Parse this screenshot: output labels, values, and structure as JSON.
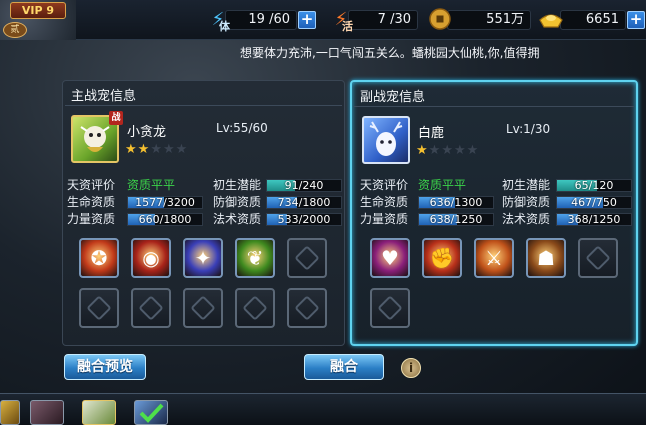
{
  "top_bar": {
    "vip_label": "VIP 9",
    "rank_label": "贰",
    "stamina": {
      "icon": "lightning-icon",
      "tag": "体",
      "value": "19 /60"
    },
    "vitality": {
      "icon": "lightning-icon",
      "tag": "活",
      "value": "7 /30"
    },
    "coins": {
      "icon": "copper-coin-icon",
      "value": "551万"
    },
    "gold": {
      "icon": "gold-ingot-icon",
      "value": "6651"
    }
  },
  "marquee": "想要体力充沛,一口气闯五关么。蟠桃园大仙桃,你,值得拥",
  "main_panel": {
    "title": "主战宠信息",
    "battle_tag": "战",
    "pet_name": "小贪龙",
    "level": "Lv:55/60",
    "stars_filled": 2,
    "stars_total": 5,
    "rating_label": "天资评价",
    "rating_value": "资质平平",
    "potential_label": "初生潜能",
    "potential_text": "91/240",
    "potential_fraction": 0.38,
    "stats": [
      {
        "label": "生命资质",
        "text": "1577/3200",
        "fraction": 0.49
      },
      {
        "label": "力量资质",
        "text": "660/1800",
        "fraction": 0.37
      }
    ],
    "stats_right": [
      {
        "label": "防御资质",
        "text": "734/1800",
        "fraction": 0.41
      },
      {
        "label": "法术资质",
        "text": "533/2000",
        "fraction": 0.27
      }
    ],
    "skills": [
      {
        "name": "shield-fire-skill-icon",
        "color": "#c13a1a"
      },
      {
        "name": "flame-ring-skill-icon",
        "color": "#a8231a"
      },
      {
        "name": "lightning-spear-skill-icon",
        "color": "#3a3fb8"
      },
      {
        "name": "poison-claw-skill-icon",
        "color": "#3f8a1f"
      }
    ]
  },
  "sub_panel": {
    "title": "副战宠信息",
    "pet_name": "白鹿",
    "level": "Lv:1/30",
    "stars_filled": 1,
    "stars_total": 5,
    "rating_label": "天资评价",
    "rating_value": "资质平平",
    "potential_label": "初生潜能",
    "potential_text": "65/120",
    "potential_fraction": 0.54,
    "stats": [
      {
        "label": "生命资质",
        "text": "636/1300",
        "fraction": 0.49
      },
      {
        "label": "力量资质",
        "text": "638/1250",
        "fraction": 0.51
      }
    ],
    "stats_right": [
      {
        "label": "防御资质",
        "text": "467/750",
        "fraction": 0.62
      },
      {
        "label": "法术资质",
        "text": "368/1250",
        "fraction": 0.29
      }
    ],
    "skills": [
      {
        "name": "heart-heal-skill-icon",
        "color": "#8a1f7a"
      },
      {
        "name": "fire-fist-skill-icon",
        "color": "#b8301a"
      },
      {
        "name": "blade-slash-skill-icon",
        "color": "#c0521a"
      },
      {
        "name": "bear-roar-skill-icon",
        "color": "#8a4a1a"
      }
    ]
  },
  "buttons": {
    "preview": "融合预览",
    "fuse": "融合",
    "info": "i"
  }
}
